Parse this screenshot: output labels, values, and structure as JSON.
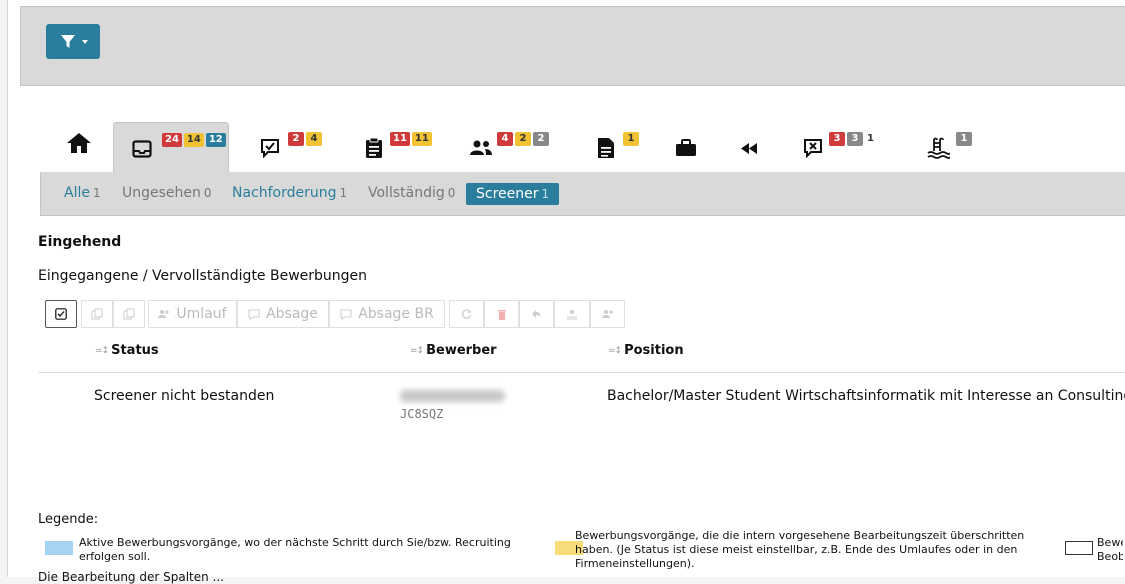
{
  "toolbar_top": {
    "filter_icon": "filter-icon"
  },
  "tabs": [
    {
      "icon": "home-icon",
      "badges": []
    },
    {
      "icon": "inbox-icon",
      "badges": [
        "24",
        "14",
        "12"
      ]
    },
    {
      "icon": "chat-check-icon",
      "badges": [
        "2",
        "4"
      ]
    },
    {
      "icon": "clipboard-icon",
      "badges": [
        "11",
        "11"
      ]
    },
    {
      "icon": "people-icon",
      "badges": [
        "4",
        "2",
        "2"
      ]
    },
    {
      "icon": "document-icon",
      "badges": [
        "1"
      ]
    },
    {
      "icon": "briefcase-icon",
      "badges": []
    },
    {
      "icon": "rewind-icon",
      "badges": []
    },
    {
      "icon": "chat-x-icon",
      "badges": [
        "3",
        "3",
        "1"
      ]
    },
    {
      "icon": "pool-icon",
      "badges": [
        "1"
      ]
    }
  ],
  "subnav": {
    "items": [
      {
        "label": "Alle",
        "count": "1"
      },
      {
        "label": "Ungesehen",
        "count": "0"
      },
      {
        "label": "Nachforderung",
        "count": "1"
      },
      {
        "label": "Vollständig",
        "count": "0"
      },
      {
        "label": "Screener",
        "count": "1"
      }
    ]
  },
  "section": {
    "title": "Eingehend",
    "subtitle": "Eingegangene / Vervollständigte Bewerbungen"
  },
  "actions": {
    "umlauf": "Umlauf",
    "absage": "Absage",
    "absage_br": "Absage BR"
  },
  "table": {
    "headers": [
      "Status",
      "Bewerber",
      "Position"
    ],
    "rows": [
      {
        "status": "Screener nicht bestanden",
        "code": "JC8SQZ",
        "position": "Bachelor/Master Student Wirtschaftsinformatik mit Interesse an Consulting"
      }
    ]
  },
  "legend": {
    "title": "Legende:",
    "items": [
      {
        "color": "#a7d3f3",
        "text": "Aktive Bewerbungsvorgänge, wo der nächste Schritt durch Sie/bzw. Recruiting erfolgen soll."
      },
      {
        "color": "#f8dc7a",
        "text": "Bewerbungsvorgänge, die die intern vorgesehene Bearbeitungszeit überschritten haben. (Je Status ist diese meist einstellbar, z.B. Ende des Umlaufes oder in den Firmeneinstellungen)."
      },
      {
        "color": "#ffffff",
        "text": "Bewe Beob"
      }
    ]
  },
  "footer_text": "Die Bearbeitung der Spalten ..."
}
